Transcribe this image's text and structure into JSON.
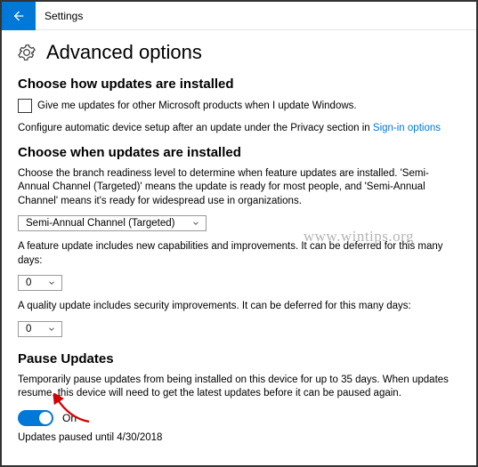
{
  "header": {
    "app_title": "Settings"
  },
  "page": {
    "title": "Advanced options"
  },
  "section_install": {
    "heading": "Choose how updates are installed",
    "checkbox_label": "Give me updates for other Microsoft products when I update Windows.",
    "config_text_before": "Configure automatic device setup after an update under the Privacy section in ",
    "config_link": "Sign-in options"
  },
  "section_when": {
    "heading": "Choose when updates are installed",
    "description": "Choose the branch readiness level to determine when feature updates are installed. 'Semi-Annual Channel (Targeted)' means the update is ready for most people, and 'Semi-Annual Channel' means it's ready for widespread use in organizations.",
    "branch_value": "Semi-Annual Channel (Targeted)",
    "feature_text": "A feature update includes new capabilities and improvements. It can be deferred for this many days:",
    "feature_value": "0",
    "quality_text": "A quality update includes security improvements. It can be deferred for this many days:",
    "quality_value": "0"
  },
  "section_pause": {
    "heading": "Pause Updates",
    "description": "Temporarily pause updates from being installed on this device for up to 35 days. When updates resume, this device will need to get the latest updates before it can be paused again.",
    "toggle_state": "On",
    "paused_until": "Updates paused until  4/30/2018"
  },
  "watermark": "www.wintips.org"
}
